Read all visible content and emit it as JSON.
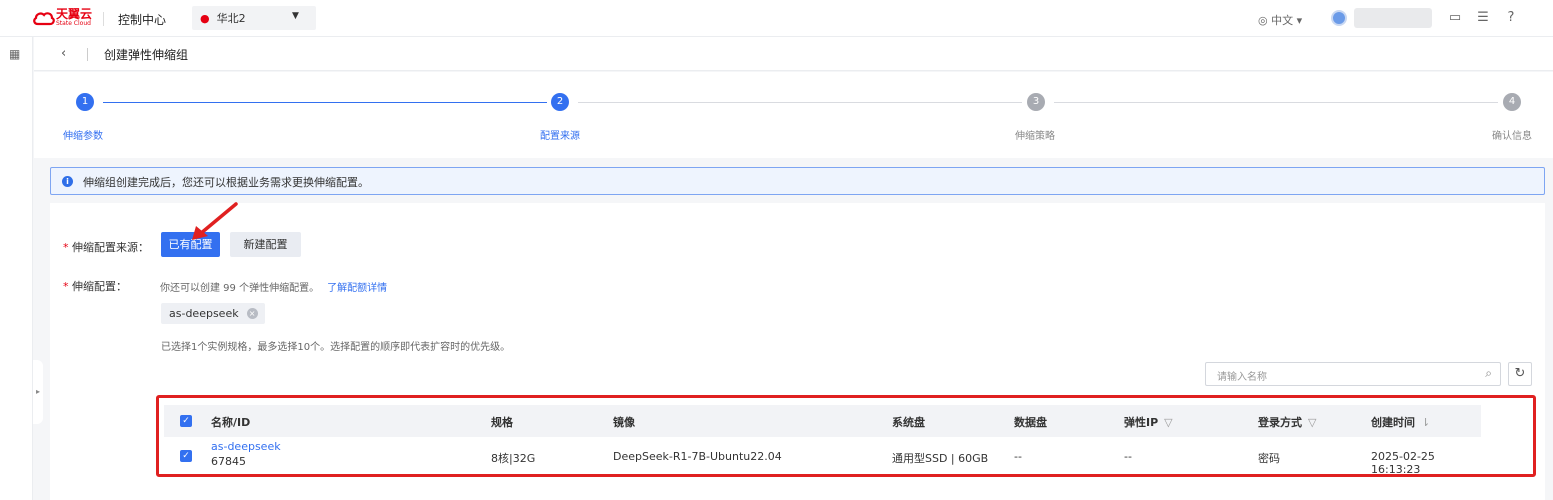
{
  "topbar": {
    "logo_cn": "天翼云",
    "logo_en": "State Cloud",
    "console": "控制中心",
    "region": "华北2",
    "lang": "中文",
    "icons": [
      "message-icon",
      "settings-icon",
      "help-icon"
    ]
  },
  "header": {
    "back_icon": "chevron-left-icon",
    "title": "创建弹性伸缩组"
  },
  "steps": [
    {
      "num": "1",
      "label": "伸缩参数",
      "state": "done"
    },
    {
      "num": "2",
      "label": "配置来源",
      "state": "active"
    },
    {
      "num": "3",
      "label": "伸缩策略",
      "state": "pending"
    },
    {
      "num": "4",
      "label": "确认信息",
      "state": "pending"
    }
  ],
  "info": {
    "text": "伸缩组创建完成后，您还可以根据业务需求更换伸缩配置。"
  },
  "form": {
    "source_label": "伸缩配置来源：",
    "btn_existing": "已有配置",
    "btn_new": "新建配置",
    "config_label": "伸缩配置：",
    "hint": "你还可以创建 99 个弹性伸缩配置。",
    "hint_link": "了解配额详情",
    "tag": "as-deepseek",
    "note": "已选择1个实例规格，最多选择10个。选择配置的顺序即代表扩容时的优先级。",
    "search_placeholder": "请输入名称"
  },
  "table": {
    "headers": [
      "名称/ID",
      "规格",
      "镜像",
      "系统盘",
      "数据盘",
      "弹性IP",
      "登录方式",
      "创建时间"
    ],
    "rows": [
      {
        "name": "as-deepseek",
        "id": "67845",
        "spec": "8核|32G",
        "image": "DeepSeek-R1-7B-Ubuntu22.04",
        "sysdisk": "通用型SSD | 60GB",
        "datadisk": "--",
        "eip": "--",
        "login": "密码",
        "created": "2025-02-25 16:13:23"
      }
    ]
  },
  "colors": {
    "primary": "#3370f0",
    "brand_red": "#e60012",
    "highlight_red": "#e02020"
  }
}
